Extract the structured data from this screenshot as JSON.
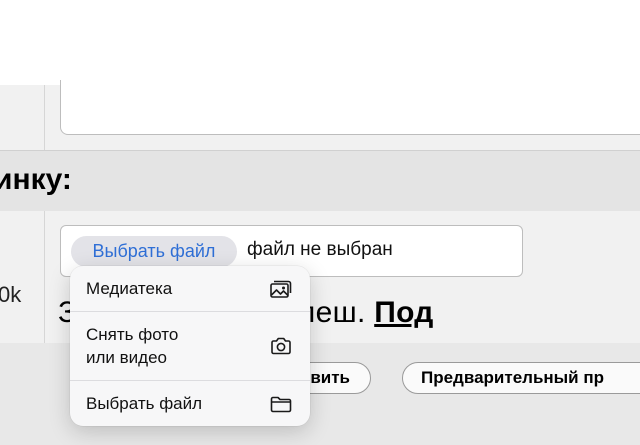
{
  "section": {
    "title": "инку:"
  },
  "upload": {
    "size_label": "0k",
    "choose_button": "Выбрать файл",
    "no_file_text": "файл не выбран",
    "hint_plain": "З         о/видео/флеш. ",
    "hint_bold": "Под"
  },
  "actions": {
    "submit_label": "вить",
    "preview_label": "Предварительный пр"
  },
  "menu": {
    "items": [
      {
        "label": "Медиатека",
        "icon": "photo-library-icon"
      },
      {
        "label": "Снять фото\nили видео",
        "line1": "Снять фото",
        "line2": "или видео",
        "icon": "camera-icon"
      },
      {
        "label": "Выбрать файл",
        "icon": "folder-icon"
      }
    ]
  },
  "colors": {
    "accent": "#2f6fd6",
    "menu_bg": "#f7f7f8",
    "header_bg": "#e4e4e4",
    "row_bg": "#f1f1f1"
  }
}
